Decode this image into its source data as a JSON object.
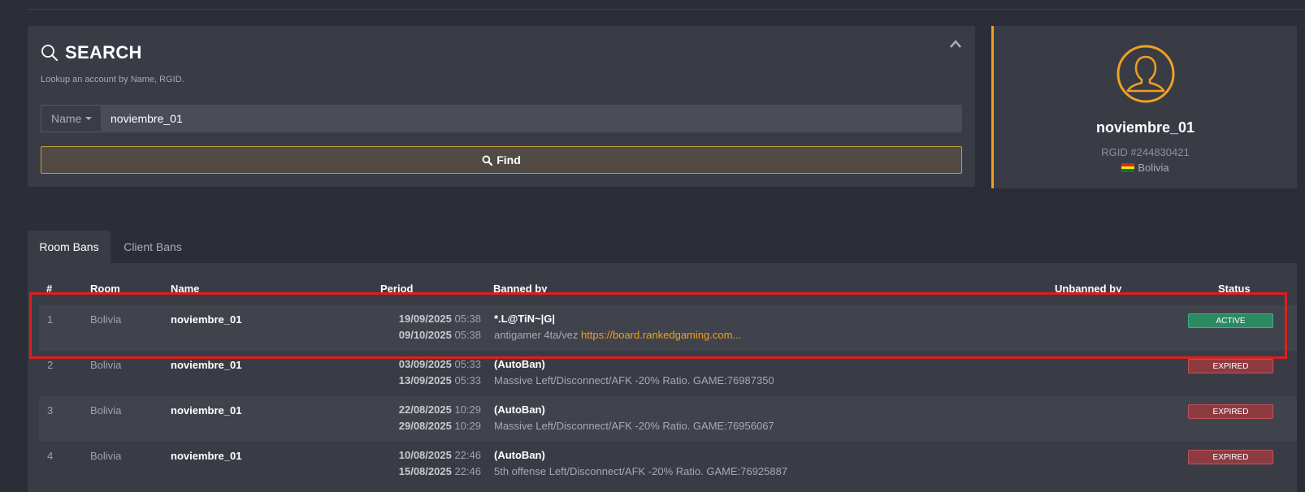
{
  "search": {
    "title": "SEARCH",
    "subtitle": "Lookup an account by Name, RGID.",
    "type_selected": "Name",
    "query": "noviembre_01",
    "find_label": "Find"
  },
  "profile": {
    "name": "noviembre_01",
    "rgid": "RGID #244830421",
    "country": "Bolivia"
  },
  "tabs": [
    {
      "label": "Room Bans",
      "active": true
    },
    {
      "label": "Client Bans",
      "active": false
    }
  ],
  "table": {
    "headers": {
      "num": "#",
      "room": "Room",
      "name": "Name",
      "period": "Period",
      "banned_by": "Banned by",
      "unbanned_by": "Unbanned by",
      "status": "Status"
    },
    "rows": [
      {
        "num": "1",
        "room": "Bolivia",
        "name": "noviembre_01",
        "start_date": "19/09/2025",
        "start_time": "05:38",
        "end_date": "09/10/2025",
        "end_time": "05:38",
        "banned_by": "*.L@TiN~|G|",
        "reason": "antigamer 4ta/vez",
        "link": "https://board.rankedgaming.com...",
        "status": "ACTIVE"
      },
      {
        "num": "2",
        "room": "Bolivia",
        "name": "noviembre_01",
        "start_date": "03/09/2025",
        "start_time": "05:33",
        "end_date": "13/09/2025",
        "end_time": "05:33",
        "banned_by": "(AutoBan)",
        "reason": "Massive Left/Disconnect/AFK -20% Ratio. GAME:76987350",
        "link": "",
        "status": "EXPIRED"
      },
      {
        "num": "3",
        "room": "Bolivia",
        "name": "noviembre_01",
        "start_date": "22/08/2025",
        "start_time": "10:29",
        "end_date": "29/08/2025",
        "end_time": "10:29",
        "banned_by": "(AutoBan)",
        "reason": "Massive Left/Disconnect/AFK -20% Ratio. GAME:76956067",
        "link": "",
        "status": "EXPIRED"
      },
      {
        "num": "4",
        "room": "Bolivia",
        "name": "noviembre_01",
        "start_date": "10/08/2025",
        "start_time": "22:46",
        "end_date": "15/08/2025",
        "end_time": "22:46",
        "banned_by": "(AutoBan)",
        "reason": "5th offense Left/Disconnect/AFK -20% Ratio. GAME:76925887",
        "link": "",
        "status": "EXPIRED"
      }
    ]
  },
  "colors": {
    "accent": "#f0a020",
    "active": "#2c8a63",
    "expired": "#8c3b41",
    "highlight": "#e01d1d"
  }
}
